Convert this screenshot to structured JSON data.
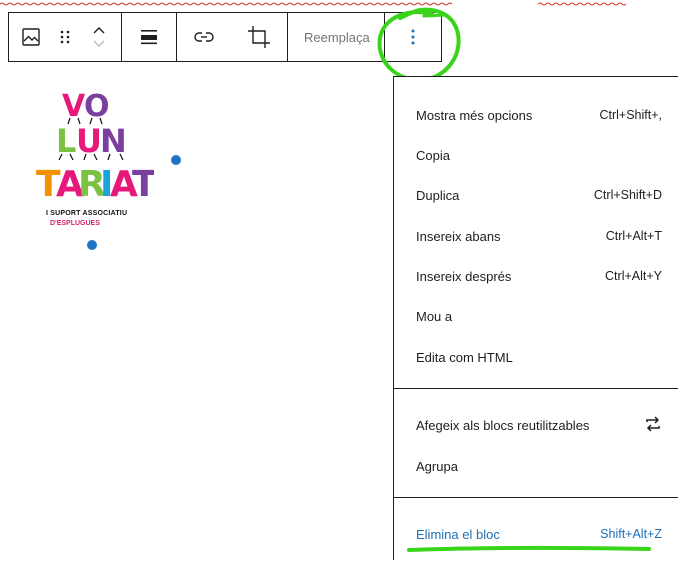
{
  "toolbar": {
    "buttons": [
      {
        "icon": "image-icon"
      },
      {
        "icon": "drag-handle-icon"
      },
      {
        "icon": "move-up-down-icon"
      },
      {
        "icon": "align-icon"
      },
      {
        "icon": "link-icon"
      },
      {
        "icon": "crop-icon"
      },
      {
        "icon": "more-options-icon"
      }
    ],
    "replace_label": "Reemplaça"
  },
  "logo": {
    "subtitle": "I SUPORT ASSOCIATIU",
    "location": "D'ESPLUGUES",
    "letters": [
      "VO",
      "LUN",
      "TARIAT"
    ],
    "colors": [
      "#e6197a",
      "#7cc242",
      "#f39200",
      "#7b3fa0",
      "#1ca3dc"
    ]
  },
  "menu": {
    "items_group1": [
      {
        "label": "Mostra més opcions",
        "shortcut": "Ctrl+Shift+,"
      },
      {
        "label": "Copia",
        "shortcut": ""
      },
      {
        "label": "Duplica",
        "shortcut": "Ctrl+Shift+D"
      },
      {
        "label": "Insereix abans",
        "shortcut": "Ctrl+Alt+T"
      },
      {
        "label": "Insereix després",
        "shortcut": "Ctrl+Alt+Y"
      },
      {
        "label": "Mou a",
        "shortcut": ""
      },
      {
        "label": "Edita com HTML",
        "shortcut": ""
      }
    ],
    "items_group2": [
      {
        "label": "Afegeix als blocs reutilitzables",
        "icon": "reusable-icon"
      },
      {
        "label": "Agrupa"
      }
    ],
    "items_group3": [
      {
        "label": "Elimina el bloc",
        "shortcut": "Shift+Alt+Z"
      }
    ]
  },
  "colors": {
    "accent_blue": "#1e70b8",
    "handle_blue": "#1e75c4",
    "annotation_green": "#39d41a"
  }
}
